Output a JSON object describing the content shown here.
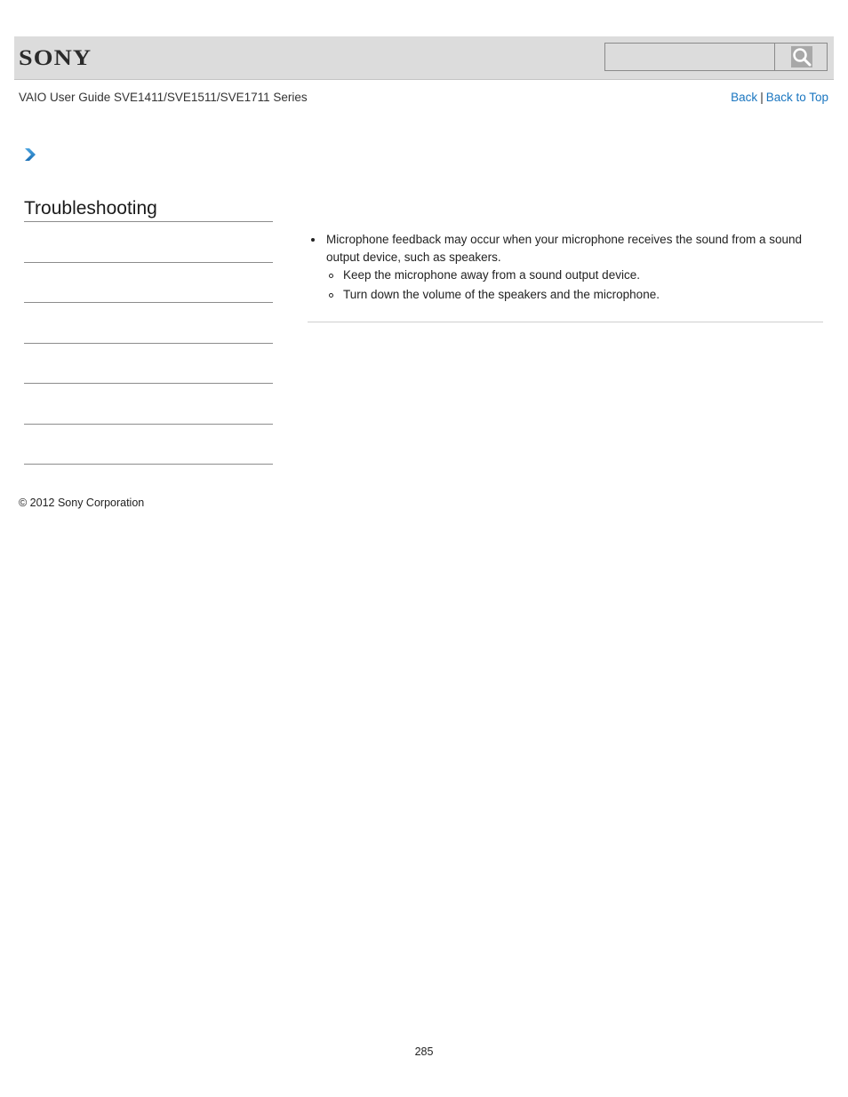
{
  "header": {
    "logo": "SONY",
    "search": {
      "value": "",
      "placeholder": "",
      "button_icon": "search-icon"
    }
  },
  "subheader": {
    "title": "VAIO User Guide SVE1411/SVE1511/SVE1711 Series",
    "back_label": "Back",
    "separator": "|",
    "back_to_top_label": "Back to Top"
  },
  "breadcrumb": {
    "icon": "chevron-right-icon",
    "color": "#1a76c0"
  },
  "sidebar": {
    "title": "Troubleshooting",
    "items": [
      "",
      "",
      "",
      "",
      "",
      ""
    ]
  },
  "content": {
    "bullets": [
      {
        "text": "Microphone feedback may occur when your microphone receives the sound from a sound output device, such as speakers.",
        "sub_items": [
          "Keep the microphone away from a sound output device.",
          "Turn down the volume of the speakers and the microphone."
        ]
      }
    ]
  },
  "footer": {
    "copyright": "© 2012 Sony Corporation",
    "page_number": "285"
  }
}
